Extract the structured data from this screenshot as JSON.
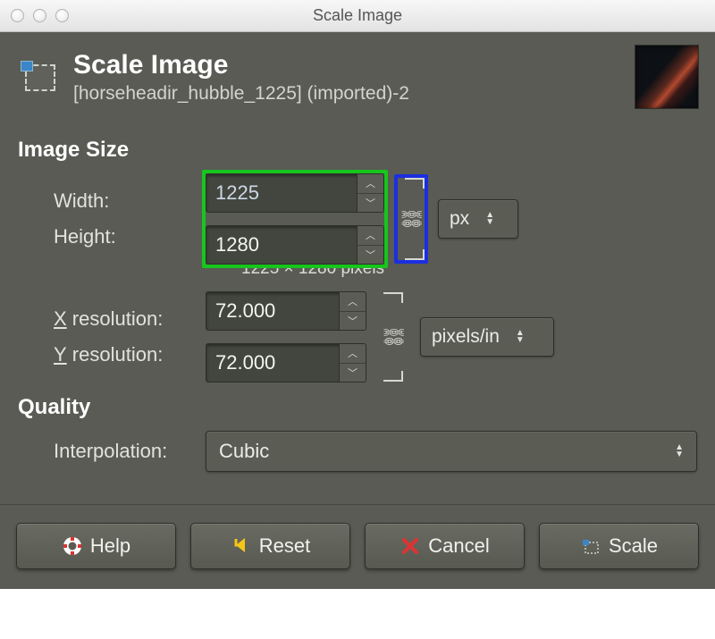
{
  "window": {
    "title": "Scale Image"
  },
  "header": {
    "title": "Scale Image",
    "subtitle": "[horseheadir_hubble_1225] (imported)-2"
  },
  "image_size": {
    "section_label": "Image Size",
    "width_label": "Width:",
    "width_value": "1225",
    "height_label": "Height:",
    "height_value": "1280",
    "dimensions_info": "1225 × 1280 pixels",
    "unit": "px",
    "xres_label": "X resolution:",
    "xres_value": "72.000",
    "yres_label": "Y resolution:",
    "yres_value": "72.000",
    "res_unit": "pixels/in"
  },
  "quality": {
    "section_label": "Quality",
    "interp_label": "Interpolation:",
    "interp_value": "Cubic"
  },
  "buttons": {
    "help": "Help",
    "reset": "Reset",
    "cancel": "Cancel",
    "scale": "Scale"
  }
}
